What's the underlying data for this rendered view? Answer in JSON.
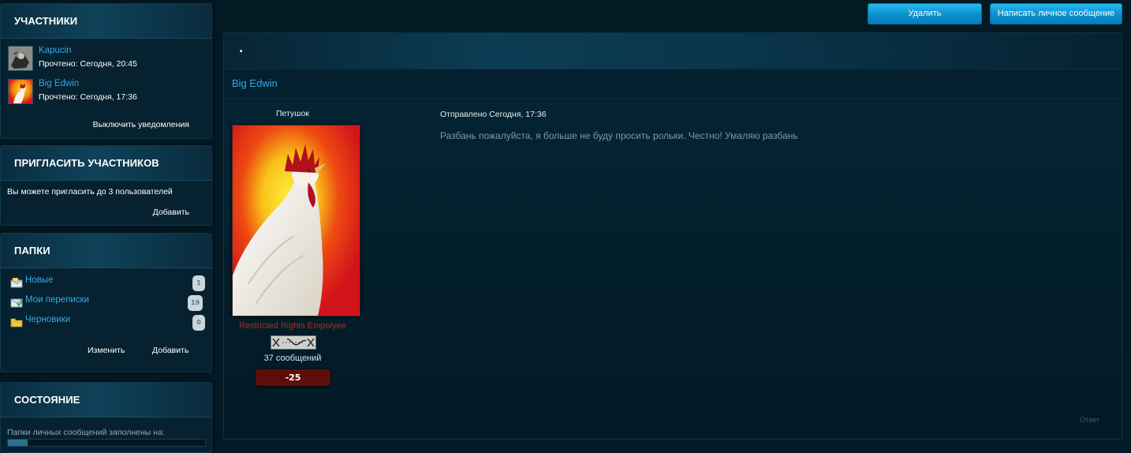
{
  "sidebar": {
    "participants": {
      "title": "Участники",
      "members": [
        {
          "name": "Kapucin",
          "read": "Прочтено: Сегодня, 20:45"
        },
        {
          "name": "Big Edwin",
          "read": "Прочтено: Сегодня, 17:36"
        }
      ],
      "disable_notifications": "Выключить уведомления"
    },
    "invite": {
      "title": "Пригласить участников",
      "text": "Вы можете пригласить до 3 пользователей",
      "add_label": "Добавить"
    },
    "folders": {
      "title": "Папки",
      "items": [
        {
          "name": "Новые",
          "count": "1",
          "icon": "new-messages-icon"
        },
        {
          "name": "Мои переписки",
          "count": "19",
          "icon": "conversations-icon"
        },
        {
          "name": "Черновики",
          "count": "0",
          "icon": "drafts-folder-icon"
        }
      ],
      "edit_label": "Изменить",
      "add_label": "Добавить"
    },
    "state": {
      "title": "Состояние",
      "text": "Папки личных сообщений заполнены на:",
      "fill_fraction": 0.1
    }
  },
  "toolbar": {
    "delete_label": "Удалить",
    "compose_label": "Написать личное сообщение"
  },
  "conversation": {
    "title": ".",
    "subject": "Big Edwin"
  },
  "post": {
    "author_title": "Петушок",
    "group": "Restricted Rights Empolyee",
    "posts_count": "37 сообщений",
    "reputation": "-25",
    "sent": "Отправлено Сегодня, 17:36",
    "text": "Разбань пожалуйста, я больше не буду просить рольки. Честно! Умаляю разбань",
    "reply_label": "Ответ"
  },
  "colors": {
    "accent": "#35a9e6",
    "button": "#0b8fcc",
    "group": "#a3301f",
    "reputation_negative": "#5e0e0a"
  }
}
